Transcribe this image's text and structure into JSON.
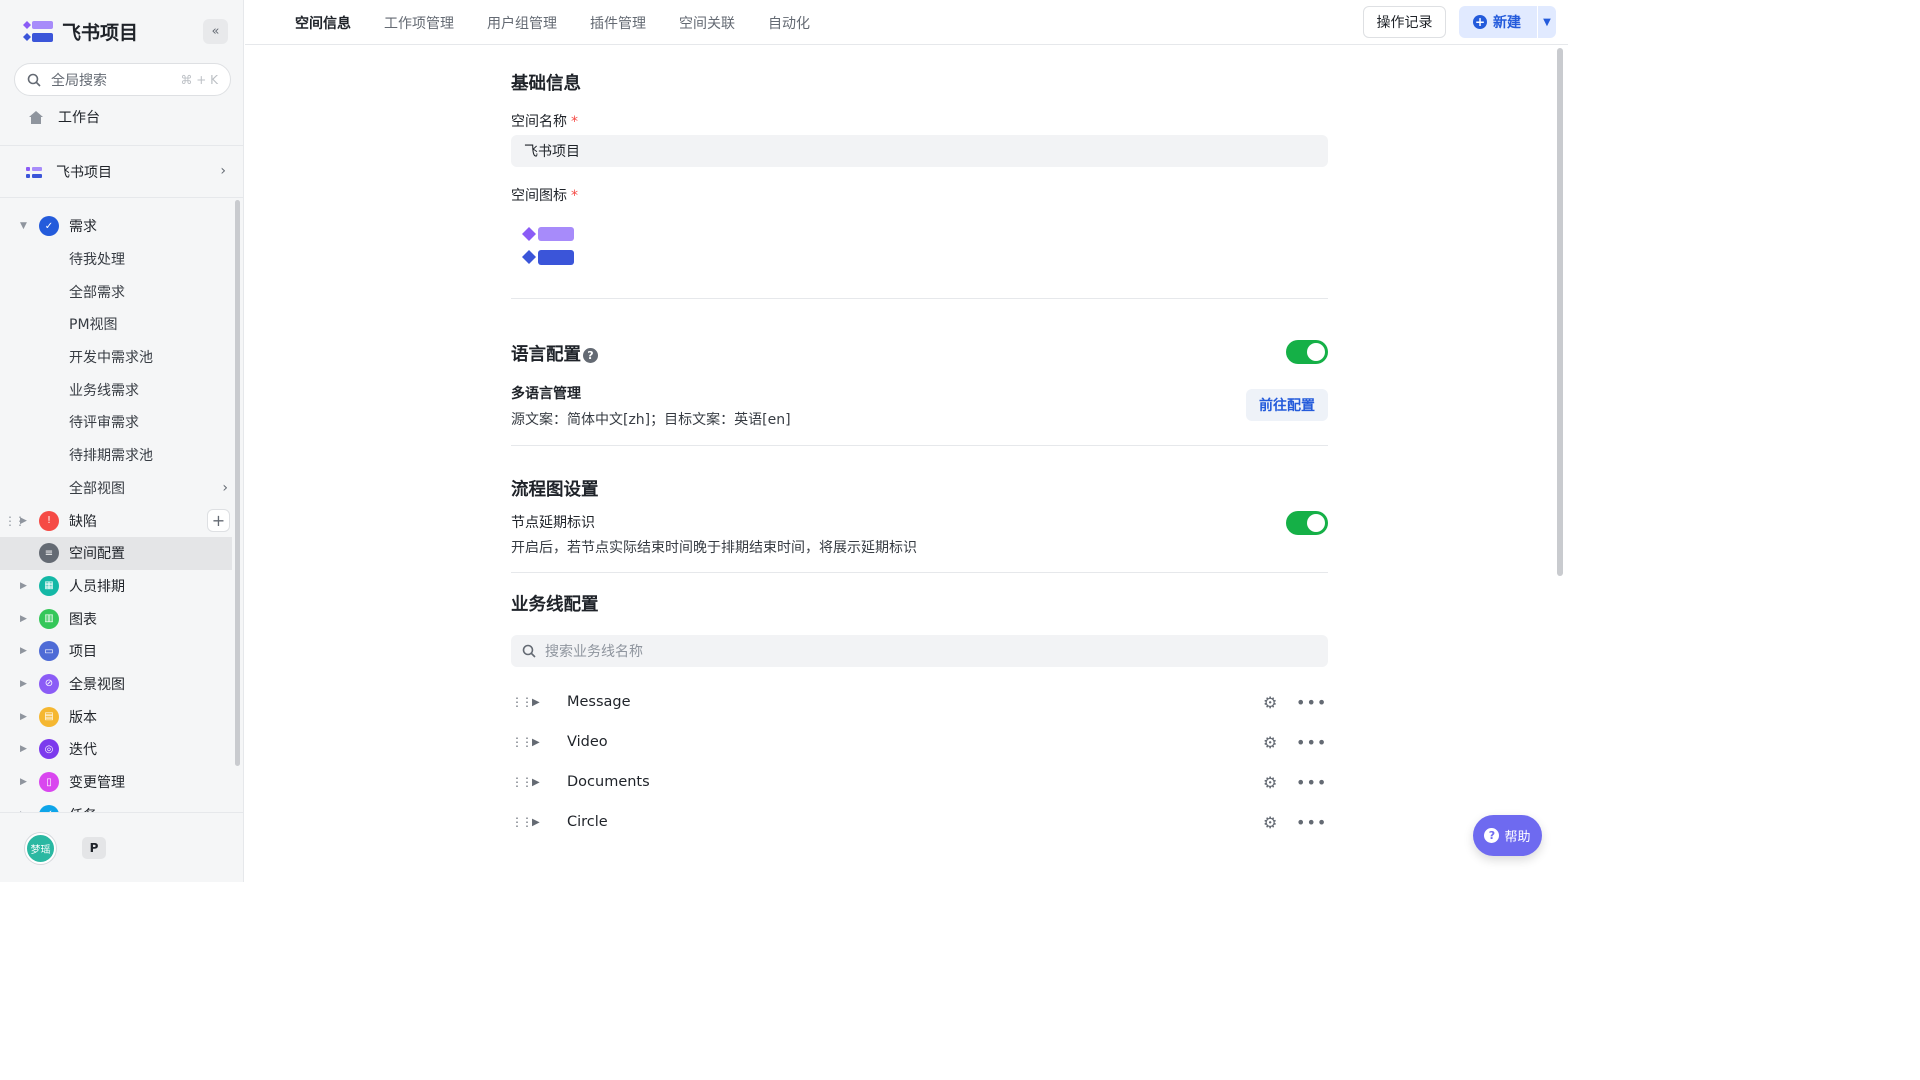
{
  "app": {
    "name": "飞书项目"
  },
  "sidebar": {
    "collapse_icon": "double-chevron-left-icon",
    "search": {
      "placeholder": "全局搜索",
      "shortcut": "⌘ + K"
    },
    "home": {
      "label": "工作台"
    },
    "space": {
      "label": "飞书项目"
    },
    "tree": [
      {
        "label": "需求",
        "type": "group",
        "expanded": true,
        "color": "#245bdb"
      },
      {
        "label": "待我处理",
        "type": "sub"
      },
      {
        "label": "全部需求",
        "type": "sub"
      },
      {
        "label": "PM视图",
        "type": "sub"
      },
      {
        "label": "开发中需求池",
        "type": "sub"
      },
      {
        "label": "业务线需求",
        "type": "sub"
      },
      {
        "label": "待评审需求",
        "type": "sub"
      },
      {
        "label": "待排期需求池",
        "type": "sub"
      },
      {
        "label": "全部视图",
        "type": "sub",
        "has_chevron": true
      },
      {
        "label": "缺陷",
        "type": "group",
        "color": "#f54a45",
        "hover": true
      },
      {
        "label": "空间配置",
        "type": "group",
        "color": "#646a73",
        "active": true
      },
      {
        "label": "人员排期",
        "type": "group",
        "color": "#14b8a6"
      },
      {
        "label": "图表",
        "type": "group",
        "color": "#34c759"
      },
      {
        "label": "项目",
        "type": "group",
        "color": "#4e6bd6"
      },
      {
        "label": "全景视图",
        "type": "group",
        "color": "#8b5cf6"
      },
      {
        "label": "版本",
        "type": "group",
        "color": "#f5b731"
      },
      {
        "label": "迭代",
        "type": "group",
        "color": "#7c3aed"
      },
      {
        "label": "变更管理",
        "type": "group",
        "color": "#d946ef"
      },
      {
        "label": "任务",
        "type": "group",
        "color": "#0ea5e9"
      }
    ],
    "user": {
      "avatar_text": "梦瑶",
      "badge": "P"
    }
  },
  "topbar": {
    "tabs": [
      {
        "label": "空间信息",
        "active": true
      },
      {
        "label": "工作项管理"
      },
      {
        "label": "用户组管理"
      },
      {
        "label": "插件管理"
      },
      {
        "label": "空间关联"
      },
      {
        "label": "自动化"
      }
    ],
    "log_button": "操作记录",
    "new_button": "新建"
  },
  "basic": {
    "title": "基础信息",
    "name_label": "空间名称",
    "required_mark": "*",
    "name_value": "飞书项目",
    "icon_label": "空间图标"
  },
  "language": {
    "title": "语言配置",
    "enabled": true,
    "sub_title": "多语言管理",
    "desc": "源文案：简体中文[zh]；目标文案：英语[en]",
    "goto_button": "前往配置"
  },
  "flow": {
    "title": "流程图设置",
    "enabled": true,
    "sub_title": "节点延期标识",
    "desc": "开启后，若节点实际结束时间晚于排期结束时间，将展示延期标识"
  },
  "business": {
    "title": "业务线配置",
    "search_placeholder": "搜索业务线名称",
    "rows": [
      {
        "name": "Message"
      },
      {
        "name": "Video"
      },
      {
        "name": "Documents"
      },
      {
        "name": "Circle"
      }
    ]
  },
  "help": {
    "label": "帮助"
  },
  "colors": {
    "accent": "#245bdb",
    "toggle_on": "#15b047",
    "help_fab": "#6e6af0"
  }
}
